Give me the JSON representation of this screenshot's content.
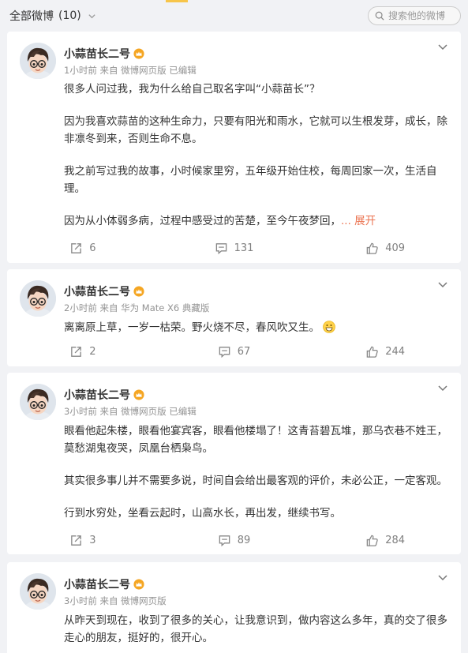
{
  "header": {
    "filter_label": "全部微博",
    "filter_count": "(10)",
    "search_placeholder": "搜索他的微博"
  },
  "posts": [
    {
      "author": "小蒜苗长二号",
      "meta": "1小时前 来自 微博网页版 已编辑",
      "paragraphs": [
        "很多人问过我，我为什么给自己取名字叫“小蒜苗长”？",
        "因为我喜欢蒜苗的这种生命力，只要有阳光和雨水，它就可以生根发芽，成长，除非凛冬到来，否则生命不息。",
        "我之前写过我的故事，小时候家里穷，五年级开始住校，每周回家一次，生活自理。",
        "因为从小体弱多病，过程中感受过的苦楚，至今午夜梦回，"
      ],
      "expand_label": "... 展开",
      "reposts": "6",
      "comments": "131",
      "likes": "409"
    },
    {
      "author": "小蒜苗长二号",
      "meta": "2小时前 来自 华为 Mate X6 典藏版",
      "paragraphs": [
        "离离原上草，一岁一枯荣。野火烧不尽，春风吹又生。"
      ],
      "reposts": "2",
      "comments": "67",
      "likes": "244"
    },
    {
      "author": "小蒜苗长二号",
      "meta": "3小时前 来自 微博网页版 已编辑",
      "paragraphs": [
        "眼看他起朱楼，眼看他宴宾客，眼看他楼塌了！这青苔碧瓦堆，那乌衣巷不姓王，莫愁湖鬼夜哭，凤凰台栖枭鸟。",
        "其实很多事儿并不需要多说，时间自会给出最客观的评价，未必公正，一定客观。",
        "行到水穷处，坐看云起时，山高水长，再出发，继续书写。"
      ],
      "reposts": "3",
      "comments": "89",
      "likes": "284"
    },
    {
      "author": "小蒜苗长二号",
      "meta": "3小时前 来自 微博网页版",
      "paragraphs": [
        "从昨天到现在，收到了很多的关心，让我意识到，做内容这么多年，真的交了很多走心的朋友，挺好的，很开心。"
      ]
    }
  ],
  "colors": {
    "expand_link": "#eb7350",
    "meta_text": "#939393",
    "page_bg": "#f1f2f5",
    "crown": "#f5a623"
  },
  "icons": {
    "search": "search-icon",
    "more": "chevron-down-icon",
    "repost": "repost-icon",
    "comment": "comment-icon",
    "like": "thumbs-up-icon",
    "verified": "crown-icon",
    "emoji": "grin-emoji-icon"
  }
}
